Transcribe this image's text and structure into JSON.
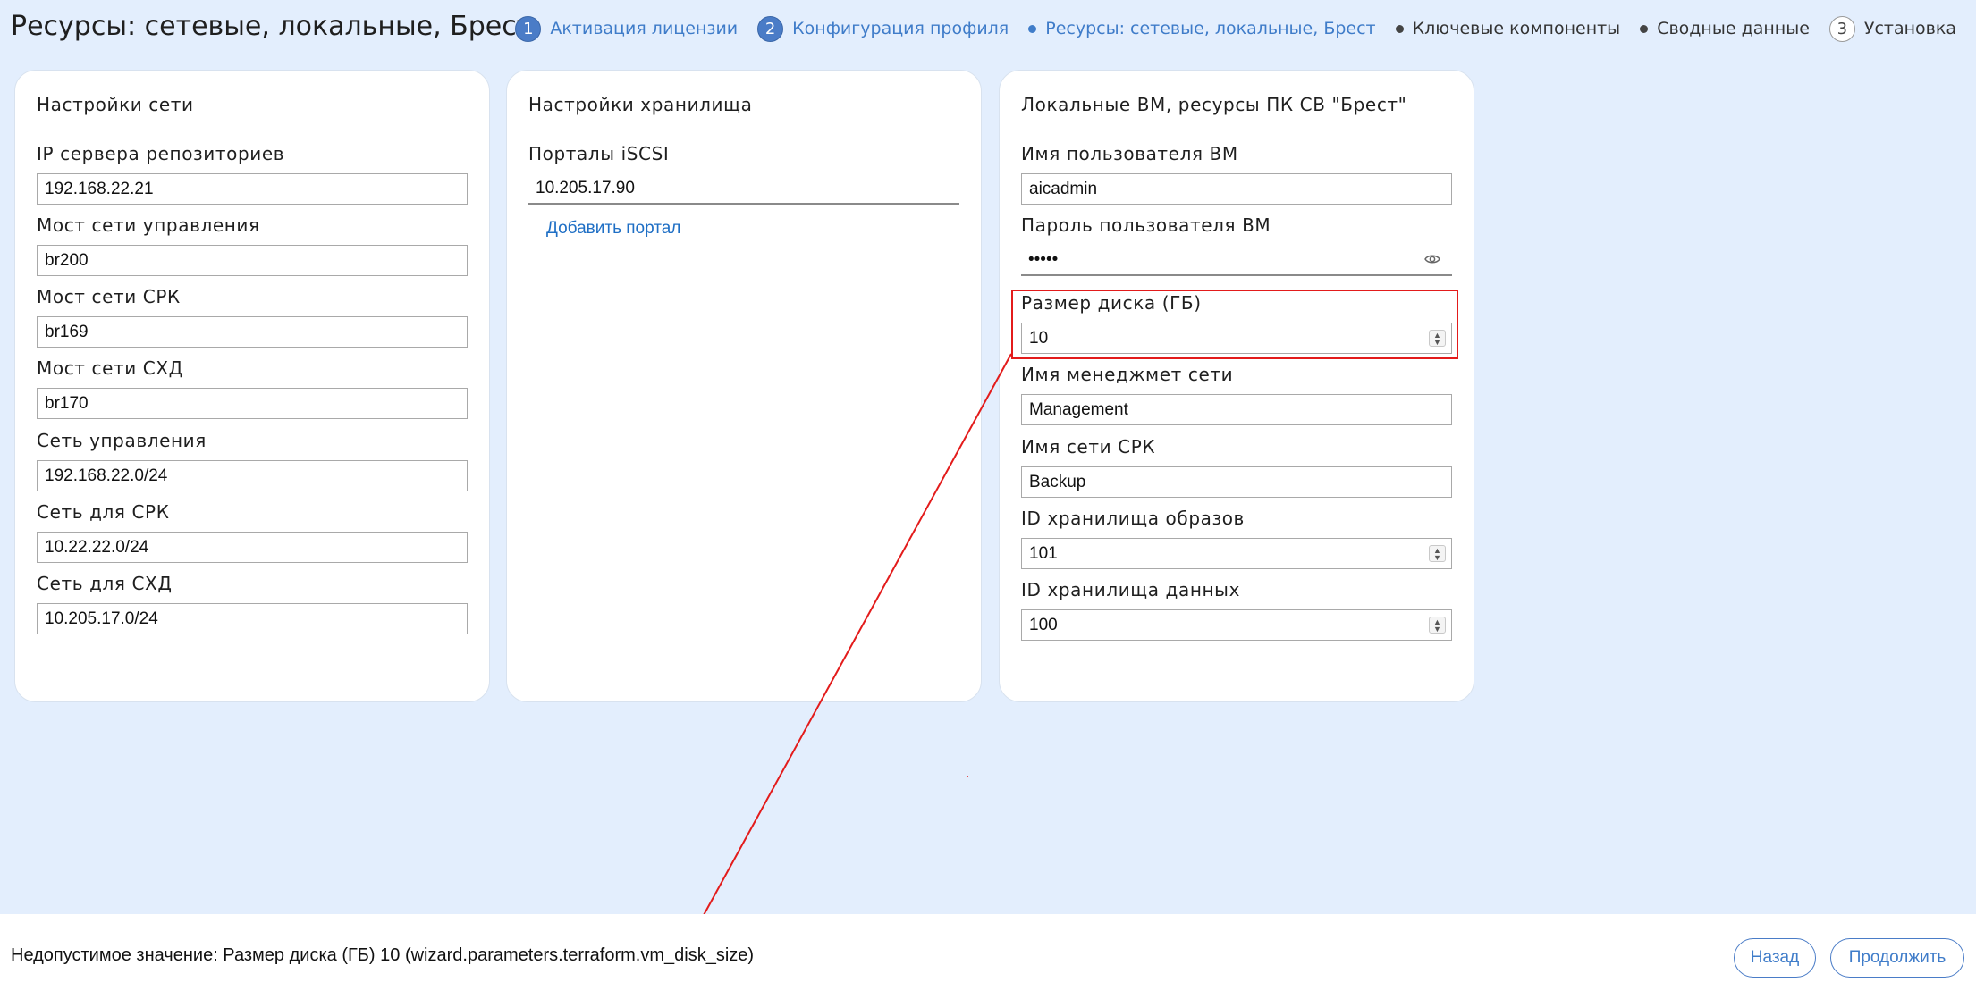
{
  "header": {
    "title": "Ресурсы: сетевые, локальные, Брест",
    "steps": [
      {
        "num": "1",
        "label": "Активация лицензии"
      },
      {
        "num": "2",
        "label": "Конфигурация профиля"
      },
      {
        "label": "Ресурсы: сетевые, локальные, Брест"
      },
      {
        "label": "Ключевые компоненты"
      },
      {
        "label": "Сводные данные"
      },
      {
        "num": "3",
        "label": "Установка"
      }
    ]
  },
  "network": {
    "title": "Настройки сети",
    "fields": [
      {
        "label": "IP сервера репозиториев",
        "value": "192.168.22.21"
      },
      {
        "label": "Мост сети управления",
        "value": "br200"
      },
      {
        "label": "Мост сети СРК",
        "value": "br169"
      },
      {
        "label": "Мост сети СХД",
        "value": "br170"
      },
      {
        "label": "Сеть управления",
        "value": "192.168.22.0/24"
      },
      {
        "label": "Сеть для СРК",
        "value": "10.22.22.0/24"
      },
      {
        "label": "Сеть для СХД",
        "value": "10.205.17.0/24"
      }
    ]
  },
  "storage": {
    "title": "Настройки хранилища",
    "portals_label": "Порталы iSCSI",
    "portal_value": "10.205.17.90",
    "add_portal": "Добавить портал"
  },
  "local_vm": {
    "title": "Локальные ВМ, ресурсы ПК СВ \"Брест\"",
    "user_label": "Имя пользователя ВМ",
    "user_value": "aicadmin",
    "password_label": "Пароль пользователя ВМ",
    "password_value": "•••••",
    "disk_label": "Размер диска (ГБ)",
    "disk_value": "10",
    "mgmt_net_label": "Имя менеджмет сети",
    "mgmt_net_value": "Management",
    "srk_net_label": "Имя сети СРК",
    "srk_net_value": "Backup",
    "image_store_label": "ID хранилища образов",
    "image_store_value": "101",
    "data_store_label": "ID хранилища данных",
    "data_store_value": "100"
  },
  "footer": {
    "status": "Недопустимое значение: Размер диска (ГБ) 10 (wizard.parameters.terraform.vm_disk_size)",
    "back": "Назад",
    "continue": "Продолжить"
  },
  "colors": {
    "background": "#e3eefd",
    "accent": "#3f7cc9",
    "error": "#e31b1b"
  }
}
